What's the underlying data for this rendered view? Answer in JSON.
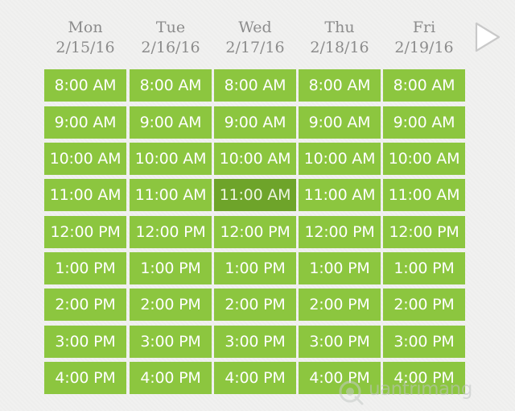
{
  "days": [
    {
      "name": "Mon",
      "date": "2/15/16",
      "slots": [
        "8:00 AM",
        "9:00 AM",
        "10:00 AM",
        "11:00 AM",
        "12:00 PM",
        "1:00 PM",
        "2:00 PM",
        "3:00 PM",
        "4:00 PM"
      ]
    },
    {
      "name": "Tue",
      "date": "2/16/16",
      "slots": [
        "8:00 AM",
        "9:00 AM",
        "10:00 AM",
        "11:00 AM",
        "12:00 PM",
        "1:00 PM",
        "2:00 PM",
        "3:00 PM",
        "4:00 PM"
      ]
    },
    {
      "name": "Wed",
      "date": "2/17/16",
      "slots": [
        "8:00 AM",
        "9:00 AM",
        "10:00 AM",
        "11:00 AM",
        "12:00 PM",
        "1:00 PM",
        "2:00 PM",
        "3:00 PM",
        "4:00 PM"
      ]
    },
    {
      "name": "Thu",
      "date": "2/18/16",
      "slots": [
        "8:00 AM",
        "9:00 AM",
        "10:00 AM",
        "11:00 AM",
        "12:00 PM",
        "1:00 PM",
        "2:00 PM",
        "3:00 PM",
        "4:00 PM"
      ]
    },
    {
      "name": "Fri",
      "date": "2/19/16",
      "slots": [
        "8:00 AM",
        "9:00 AM",
        "10:00 AM",
        "11:00 AM",
        "12:00 PM",
        "1:00 PM",
        "2:00 PM",
        "3:00 PM",
        "4:00 PM"
      ]
    }
  ],
  "selected": {
    "day": "Wed",
    "slot": "11:00 AM"
  },
  "icons": {
    "next": "next-arrow-icon",
    "watermark": "watermark-logo-icon"
  },
  "watermark": {
    "text": "uantrimang"
  },
  "colors": {
    "slot": "#8cc63f",
    "slot_selected": "#6ea42a",
    "slot_text": "#ffffff",
    "header_text": "#8c8c8c",
    "background": "#f1f1f0"
  }
}
